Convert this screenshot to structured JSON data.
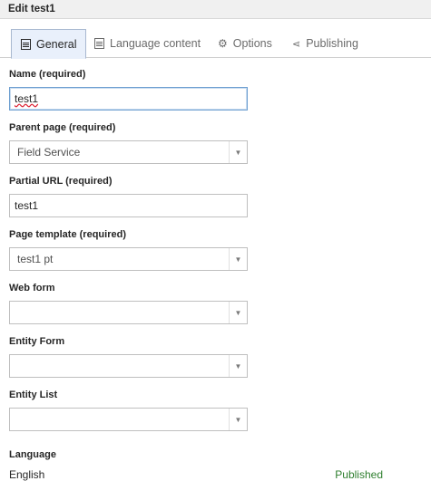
{
  "window": {
    "title": "Edit test1"
  },
  "tabs": [
    {
      "label": "General",
      "icon": "document-icon",
      "active": true
    },
    {
      "label": "Language content",
      "icon": "document-icon",
      "active": false
    },
    {
      "label": "Options",
      "icon": "gear-icon",
      "active": false
    },
    {
      "label": "Publishing",
      "icon": "share-icon",
      "active": false
    }
  ],
  "form": {
    "name": {
      "label": "Name (required)",
      "value": "test1"
    },
    "parent_page": {
      "label": "Parent page (required)",
      "value": "Field Service"
    },
    "partial_url": {
      "label": "Partial URL (required)",
      "value": "test1"
    },
    "page_template": {
      "label": "Page template (required)",
      "value": "test1 pt"
    },
    "web_form": {
      "label": "Web form",
      "value": ""
    },
    "entity_form": {
      "label": "Entity Form",
      "value": ""
    },
    "entity_list": {
      "label": "Entity List",
      "value": ""
    },
    "language": {
      "label": "Language",
      "value": "English",
      "status": "Published"
    }
  },
  "colors": {
    "published": "#2f7f2f",
    "focus_border": "#6e9fd1",
    "active_tab_bg": "#e9f0fb"
  }
}
